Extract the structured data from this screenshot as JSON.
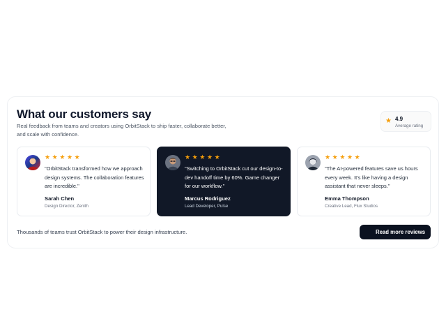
{
  "section": {
    "title": "What our customers say",
    "subtitle": "Real feedback from teams and creators using OrbitStack to ship faster, collaborate better, and scale with confidence."
  },
  "rating": {
    "star": "★",
    "value": "4.9",
    "label": "Average rating"
  },
  "testimonials": [
    {
      "stars": "★★★★★",
      "rating": 5,
      "quote": "\"OrbitStack transformed how we approach design systems. The collaboration features are incredible.\"",
      "name": "Sarah Chen",
      "role": "Design Director, Zenith",
      "theme": "light"
    },
    {
      "stars": "★★★★★",
      "rating": 5,
      "quote": "\"Switching to OrbitStack cut our design-to-dev handoff time by 60%. Game changer for our workflow.\"",
      "name": "Marcus Rodriguez",
      "role": "Lead Developer, Pulse",
      "theme": "dark"
    },
    {
      "stars": "★★★★★",
      "rating": 5,
      "quote": "\"The AI-powered features save us hours every week. It's like having a design assistant that never sleeps.\"",
      "name": "Emma Thompson",
      "role": "Creative Lead, Flux Studios",
      "theme": "light"
    }
  ],
  "footer": {
    "text": "Thousands of teams trust OrbitStack to power their design infrastructure.",
    "cta_label": "Read more reviews"
  },
  "colors": {
    "accent_star": "#f59e0b",
    "dark_card": "#111827",
    "button": "#0b1220"
  }
}
